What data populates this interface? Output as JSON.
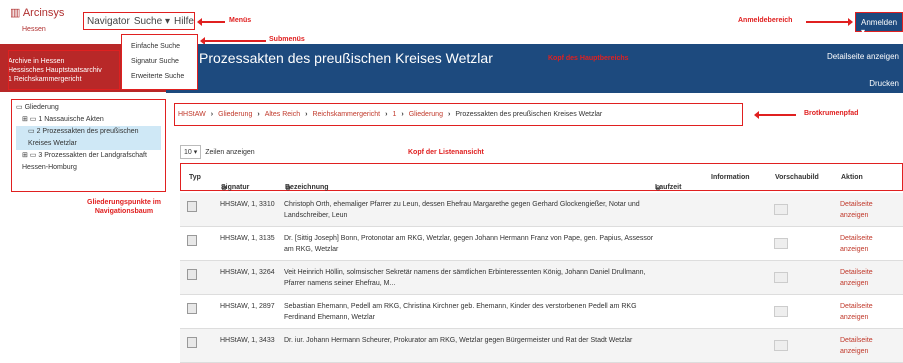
{
  "topbar": {
    "logo": "Arcinsys",
    "logo_sub": "Hessen",
    "nav": [
      "Navigator",
      "Suche ▾",
      "Hilfe"
    ],
    "login": "Anmelden ▾"
  },
  "submenu": [
    "Einfache Suche",
    "Signatur Suche",
    "Erweiterte Suche"
  ],
  "sidebar": {
    "lines": [
      "Archive in Hessen",
      "Hessisches Hauptstaatsarchiv",
      "1 Reichskammergericht"
    ]
  },
  "main_header": {
    "title": "Prozessakten des preußischen Kreises Wetzlar",
    "detail": "Detailseite anzeigen",
    "print": "Drucken"
  },
  "tree": {
    "root": "Gliederung",
    "items": [
      "1 Nassauische Akten",
      "2 Prozessakten des preußischen Kreises Wetzlar",
      "3 Prozessakten der Landgrafschaft Hessen-Homburg"
    ]
  },
  "breadcrumb": [
    "HHStAW",
    "Gliederung",
    "Altes Reich",
    "Reichskammergericht",
    "1",
    "Gliederung",
    "Prozessakten des preußischen Kreises Wetzlar"
  ],
  "rows_control": {
    "value": "10 ▾",
    "label": "Zeilen anzeigen"
  },
  "table": {
    "headers": {
      "typ": "Typ",
      "sig": "Signatur",
      "bez": "Bezeichnung",
      "laufzeit": "Laufzeit",
      "info": "Information",
      "vorschau": "Vorschaubild",
      "aktion": "Aktion"
    },
    "rows": [
      {
        "sig": "HHStAW, 1, 3310",
        "bez": "Christoph Orth, ehemaliger Pfarrer zu Leun, dessen Ehefrau Margarethe gegen Gerhard Glockengießer, Notar und Landschreiber, Leun",
        "act": "Detailseite anzeigen"
      },
      {
        "sig": "HHStAW, 1, 3135",
        "bez": "Dr. [Sittig Joseph] Bonn, Protonotar am RKG, Wetzlar, gegen Johann Hermann Franz von Pape, gen. Papius, Assessor am RKG, Wetzlar",
        "act": "Detailseite anzeigen"
      },
      {
        "sig": "HHStAW, 1, 3264",
        "bez": "Veit Heinrich Höllin, solmsischer Sekretär namens der sämtlichen Erbinteressenten König, Johann Daniel Drullmann, Pfarrer namens seiner Ehefrau, M...",
        "act": "Detailseite anzeigen"
      },
      {
        "sig": "HHStAW, 1, 2897",
        "bez": "Sebastian Ehemann, Pedell am RKG, Christina Kirchner geb. Ehemann, Kinder des verstorbenen Pedell am RKG Ferdinand Ehemann, Wetzlar",
        "act": "Detailseite anzeigen"
      },
      {
        "sig": "HHStAW, 1, 3433",
        "bez": "Dr. iur. Johann Hermann Scheurer, Prokurator am RKG, Wetzlar gegen Bürgermeister und Rat der Stadt Wetzlar",
        "act": "Detailseite anzeigen"
      }
    ]
  },
  "annotations": {
    "menus": "Menüs",
    "submenus": "Submenüs",
    "login_area": "Anmeldebereich",
    "main_header": "Kopf des Hauptbereichs",
    "breadcrumb": "Brotkrumenpfad",
    "list_header": "Kopf der Listenansicht",
    "tree_points": "Gliederungspunkte im Navigationsbaum"
  }
}
